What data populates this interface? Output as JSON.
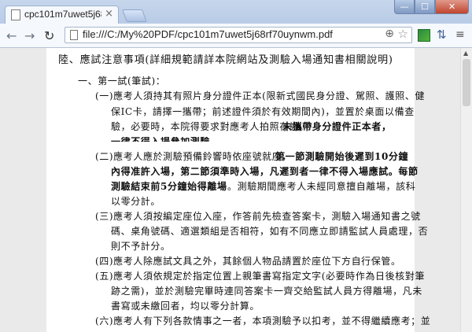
{
  "tab": {
    "title": "cpc101m7uwet5j68rf70u",
    "close": "×"
  },
  "window": {
    "min": "—",
    "max": "☐",
    "close": "✕"
  },
  "toolbar": {
    "back": "←",
    "forward": "→",
    "reload": "↻",
    "url": "file:///C:/My%20PDF/cpc101m7uwet5j68rf70uynwm.pdf",
    "menu": "≡"
  },
  "doc": {
    "heading": "陸、應試注意事項(詳細規範請詳本院網站及測驗入場通知書相關說明)",
    "sub1": "一、第一試(筆試)：",
    "l01": "(一)應考人須持其有照片身分證件正本(限新式國民身分證、駕照、護照、健",
    "l02": "保IC卡，請擇一攜帶；前述證件須於有效期間內)，並置於桌面以備查",
    "l03a": "驗，必要時，本院得要求對應考人拍照存證。",
    "l03b": "未攜帶身分證件正本者，",
    "l04": "一律不得入場參加測驗。",
    "l05a": "(二)應考人應於測驗預備鈴響時依座號就座，",
    "l05b": "第一節測驗開始後遲到10分鐘",
    "l06": "內得准許入場，第二節須準時入場，凡遲到者一律不得入場應試。每節",
    "l07a": "測驗結束前5分鐘始得離場",
    "l07b": "。測驗期間應考人未經同意擅自離場，該科",
    "l08": "以零分計。",
    "l09": "(三)應考人須按編定座位入座，作答前先檢查答案卡，測驗入場通知書之號",
    "l10": "碼、桌角號碼、適選類組是否相符，如有不同應立即請監試人員處理，否",
    "l11": "則不予計分。",
    "l12": "(四)應考人除應試文具之外，其餘個人物品請置於座位下方自行保管。",
    "l13": "(五)應考人須依規定於指定位置上親筆書寫指定文字(必要時作為日後核對筆",
    "l14": "跡之需)，並於測驗完畢時連同答案卡一齊交給監試人員方得離場，凡未",
    "l15": "書寫或未繳回者，均以零分計算。",
    "l16": "(六)應考人有下列各款情事之一者，本項測驗予以扣考，並不得繼續應考；並"
  }
}
